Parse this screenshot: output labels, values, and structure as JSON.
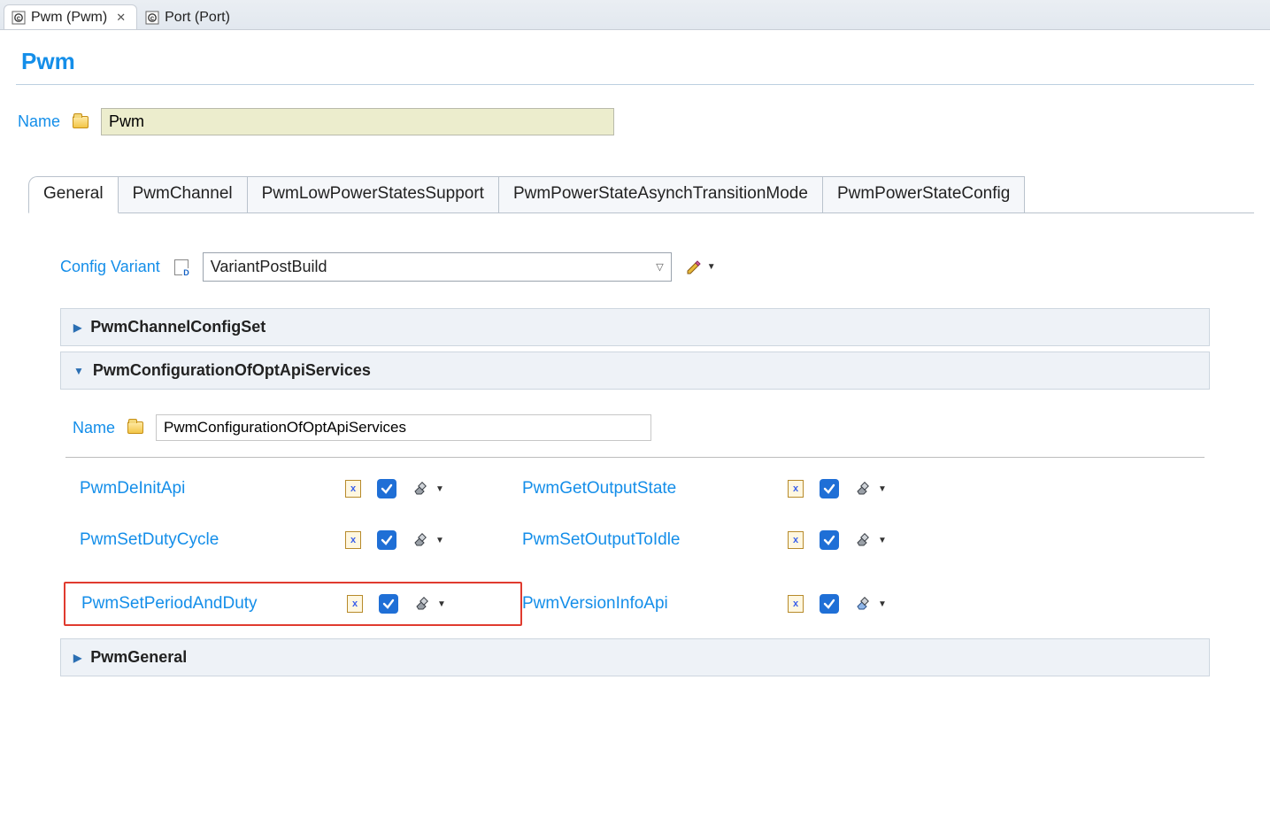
{
  "fileTabs": [
    {
      "label": "Pwm (Pwm)",
      "active": true
    },
    {
      "label": "Port (Port)",
      "active": false
    }
  ],
  "page": {
    "title": "Pwm",
    "nameLabel": "Name",
    "nameValue": "Pwm"
  },
  "configTabs": [
    "General",
    "PwmChannel",
    "PwmLowPowerStatesSupport",
    "PwmPowerStateAsynchTransitionMode",
    "PwmPowerStateConfig"
  ],
  "configActiveIndex": 0,
  "configVariant": {
    "label": "Config Variant",
    "value": "VariantPostBuild"
  },
  "sections": {
    "channelConfigSet": {
      "title": "PwmChannelConfigSet",
      "expanded": false
    },
    "optApi": {
      "title": "PwmConfigurationOfOptApiServices",
      "expanded": true,
      "nameLabel": "Name",
      "nameValue": "PwmConfigurationOfOptApiServices",
      "options": [
        {
          "label": "PwmDeInitApi",
          "checked": true,
          "highlighted": false
        },
        {
          "label": "PwmGetOutputState",
          "checked": true,
          "highlighted": false
        },
        {
          "label": "PwmSetDutyCycle",
          "checked": true,
          "highlighted": false
        },
        {
          "label": "PwmSetOutputToIdle",
          "checked": true,
          "highlighted": false
        },
        {
          "label": "PwmSetPeriodAndDuty",
          "checked": true,
          "highlighted": true
        },
        {
          "label": "PwmVersionInfoApi",
          "checked": true,
          "highlighted": false
        }
      ]
    },
    "general": {
      "title": "PwmGeneral",
      "expanded": false
    }
  }
}
